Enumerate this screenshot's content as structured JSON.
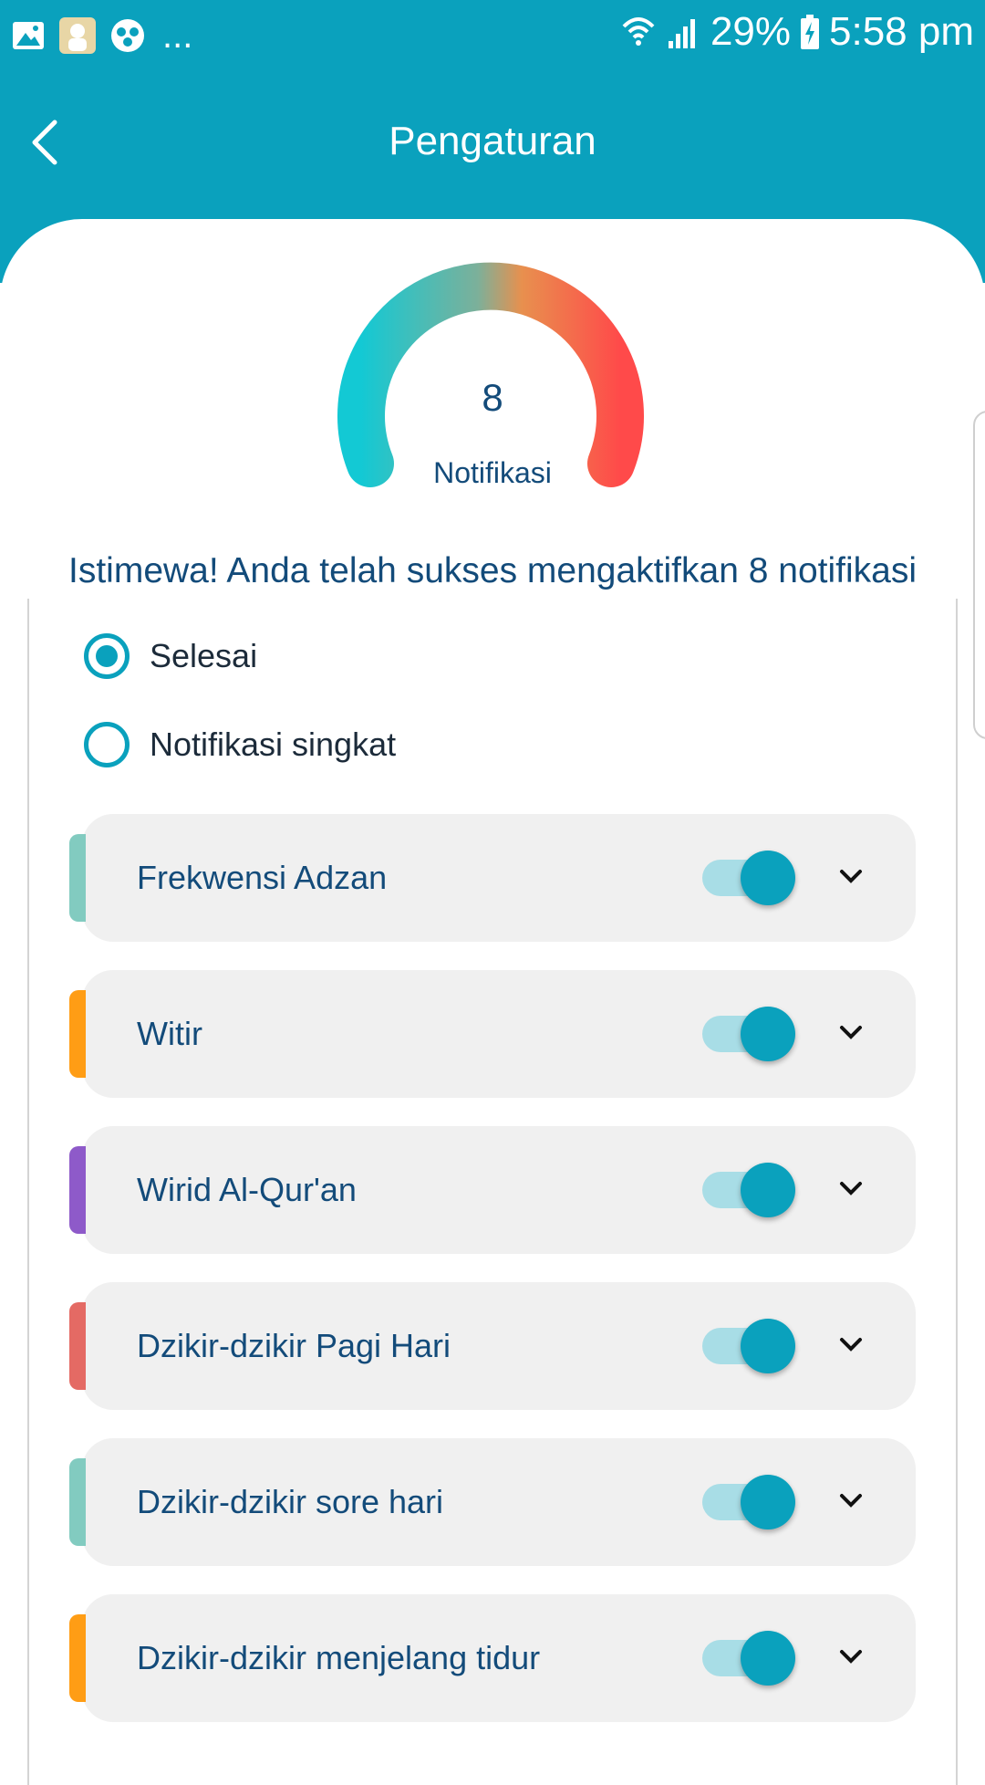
{
  "status_bar": {
    "battery": "29%",
    "time": "5:58 pm",
    "overflow": "...",
    "icons": [
      "gallery-icon",
      "app-icon",
      "app-icon-2",
      "wifi-icon",
      "signal-icon",
      "battery-charging-icon"
    ]
  },
  "header": {
    "title": "Pengaturan",
    "back_icon": "chevron-left-icon"
  },
  "gauge": {
    "value": "8",
    "label": "Notifikasi",
    "colors": [
      "#13c9d4",
      "#ff4a4a"
    ]
  },
  "headline": "Istimewa! Anda telah sukses mengaktifkan 8 notifikasi",
  "options": [
    {
      "label": "Selesai",
      "selected": true
    },
    {
      "label": "Notifikasi singkat",
      "selected": false
    }
  ],
  "items": [
    {
      "label": "Frekwensi Adzan",
      "accent": "#82cbc0",
      "enabled": true
    },
    {
      "label": "Witir",
      "accent": "#ff9d15",
      "enabled": true
    },
    {
      "label": "Wirid Al-Qur'an",
      "accent": "#8e5ac9",
      "enabled": true
    },
    {
      "label": "Dzikir-dzikir Pagi Hari",
      "accent": "#e46a64",
      "enabled": true
    },
    {
      "label": "Dzikir-dzikir sore hari",
      "accent": "#82cbc0",
      "enabled": true
    },
    {
      "label": "Dzikir-dzikir menjelang tidur",
      "accent": "#ff9d15",
      "enabled": true
    }
  ],
  "colors": {
    "primary": "#0aa1bd",
    "text": "#134b7a",
    "item_bg": "#f0f0f0"
  }
}
